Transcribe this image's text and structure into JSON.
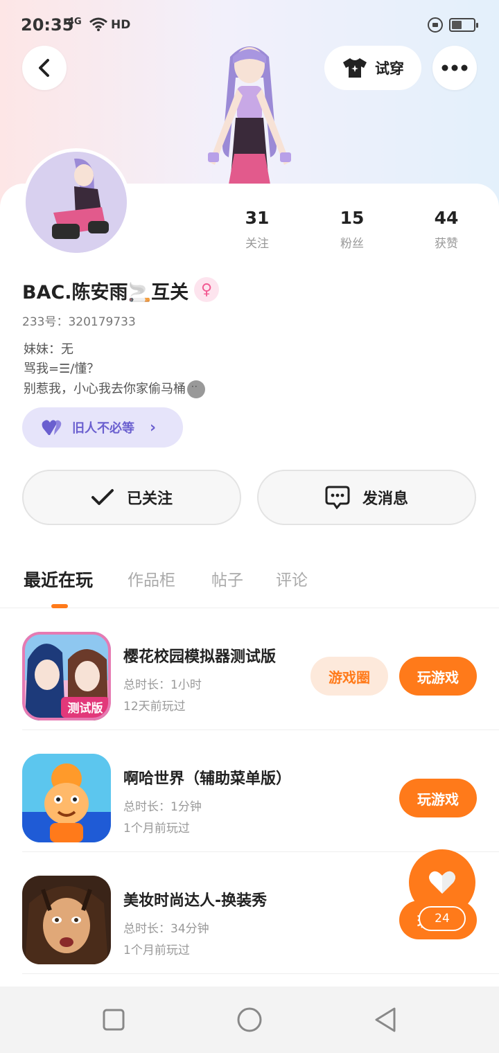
{
  "status_bar": {
    "time": "20:35",
    "network": "4G",
    "hd": "HD"
  },
  "header": {
    "tryon_label": "试穿"
  },
  "profile": {
    "username": "BAC.陈安雨🚬互关",
    "uid": "233号：320179733",
    "bio": [
      "妹妹：无",
      "骂我=☰/懂？",
      "别惹我，小心我去你家偷马桶"
    ],
    "badge_label": "旧人不必等"
  },
  "stats": [
    {
      "value": "31",
      "label": "关注"
    },
    {
      "value": "15",
      "label": "粉丝"
    },
    {
      "value": "44",
      "label": "获赞"
    }
  ],
  "actions": {
    "follow_label": "已关注",
    "message_label": "发消息"
  },
  "tabs": [
    {
      "label": "最近在玩"
    },
    {
      "label": "作品柜"
    },
    {
      "label": "帖子"
    },
    {
      "label": "评论"
    }
  ],
  "games": [
    {
      "title": "樱花校园模拟器测试版",
      "duration": "总时长：1小时",
      "last_played": "12天前玩过",
      "secondary_button": "游戏圈",
      "play_button": "玩游戏",
      "icon_text": "测试版"
    },
    {
      "title": "啊哈世界（辅助菜单版）",
      "duration": "总时长：1分钟",
      "last_played": "1个月前玩过",
      "play_button": "玩游戏"
    },
    {
      "title": "美妆时尚达人-换装秀",
      "duration": "总时长：34分钟",
      "last_played": "1个月前玩过",
      "play_button": "玩游戏"
    }
  ],
  "fab": {
    "count": "24"
  },
  "colors": {
    "accent": "#ff7a1a",
    "badge_purple": "#6a5fcf",
    "gender_pink": "#f25a92"
  }
}
